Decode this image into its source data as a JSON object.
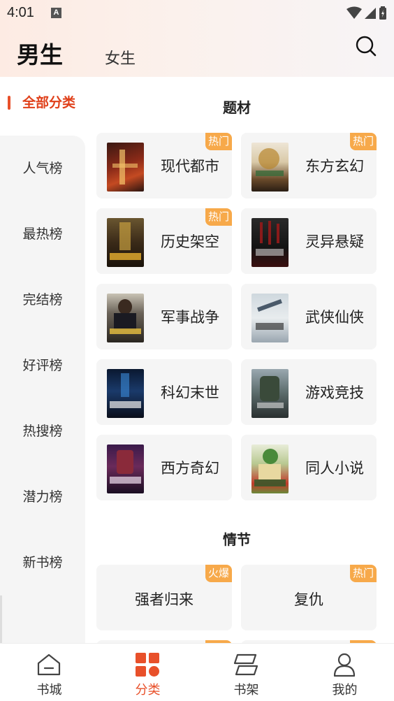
{
  "status_bar": {
    "time": "4:01",
    "badge": "A"
  },
  "header": {
    "tabs": [
      {
        "label": "男生",
        "active": true
      },
      {
        "label": "女生",
        "active": false
      }
    ],
    "search_icon": "search-icon"
  },
  "sidebar": {
    "selected": "全部分类",
    "items": [
      "人气榜",
      "最热榜",
      "完结榜",
      "好评榜",
      "热搜榜",
      "潜力榜",
      "新书榜"
    ]
  },
  "sections": {
    "theme": {
      "title": "题材",
      "cards": [
        {
          "name": "现代都市",
          "tag": "热门"
        },
        {
          "name": "东方玄幻",
          "tag": "热门"
        },
        {
          "name": "历史架空",
          "tag": "热门"
        },
        {
          "name": "灵异悬疑",
          "tag": ""
        },
        {
          "name": "军事战争",
          "tag": ""
        },
        {
          "name": "武侠仙侠",
          "tag": ""
        },
        {
          "name": "科幻末世",
          "tag": ""
        },
        {
          "name": "游戏竞技",
          "tag": ""
        },
        {
          "name": "西方奇幻",
          "tag": ""
        },
        {
          "name": "同人小说",
          "tag": ""
        }
      ]
    },
    "plot": {
      "title": "情节",
      "cards": [
        {
          "name": "强者归来",
          "tag": "火爆"
        },
        {
          "name": "复仇",
          "tag": "热门"
        }
      ]
    }
  },
  "bottom_nav": [
    {
      "label": "书城",
      "icon": "home-icon",
      "active": false
    },
    {
      "label": "分类",
      "icon": "category-icon",
      "active": true
    },
    {
      "label": "书架",
      "icon": "bookshelf-icon",
      "active": false
    },
    {
      "label": "我的",
      "icon": "profile-icon",
      "active": false
    }
  ],
  "colors": {
    "accent": "#e8502a",
    "tag": "#f7a94a",
    "card_bg": "#f5f5f5"
  }
}
